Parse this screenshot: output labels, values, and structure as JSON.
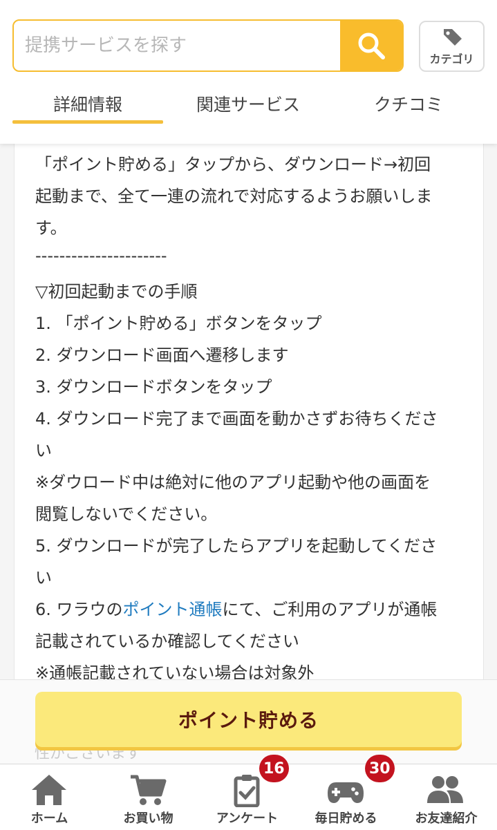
{
  "header": {
    "search": {
      "placeholder": "提携サービスを探す",
      "value": "",
      "icon": "search-icon"
    },
    "category": {
      "label": "カテゴリ",
      "icon": "tag-icon"
    },
    "tabs": [
      {
        "label": "詳細情報",
        "active": true
      },
      {
        "label": "関連サービス",
        "active": false
      },
      {
        "label": "クチコミ",
        "active": false
      }
    ]
  },
  "content": {
    "lines": [
      "「ポイント貯める」タップから、ダウンロード→初回",
      "起動まで、全て一連の流れで対応するようお願いしま",
      "す。",
      "----------------------",
      "▽初回起動までの手順",
      "1. 「ポイント貯める」ボタンをタップ",
      "2. ダウンロード画面へ遷移します",
      "3. ダウンロードボタンをタップ",
      "4. ダウンロード完了まで画面を動かさずお待ちくださ",
      "い",
      "※ダウロード中は絶対に他のアプリ起動や他の画面を",
      "閲覧しないでください。",
      "5. ダウンロードが完了したらアプリを起動してくださ",
      "い"
    ],
    "step6": {
      "prefix": "6. ワラウの",
      "link": "ポイント通帳",
      "suffix": "にて、ご利用のアプリが通帳"
    },
    "after_lines": [
      "記載されているか確認してください",
      "※通帳記載されていない場合は対象外"
    ],
    "faded_text": "性がございます"
  },
  "action": {
    "button_label": "ポイント貯める"
  },
  "bottom_nav": {
    "items": [
      {
        "label": "ホーム",
        "icon": "home-icon"
      },
      {
        "label": "お買い物",
        "icon": "cart-icon"
      },
      {
        "label": "アンケート",
        "icon": "survey-icon",
        "badge": "16"
      },
      {
        "label": "毎日貯める",
        "icon": "gamepad-icon",
        "badge": "30"
      },
      {
        "label": "お友達紹介",
        "icon": "friends-icon"
      }
    ]
  },
  "colors": {
    "accent": "#f9bc2c",
    "button": "#fbe97b",
    "button_text": "#5a1a0e",
    "link": "#1f7bbf",
    "badge": "#c3131f"
  }
}
